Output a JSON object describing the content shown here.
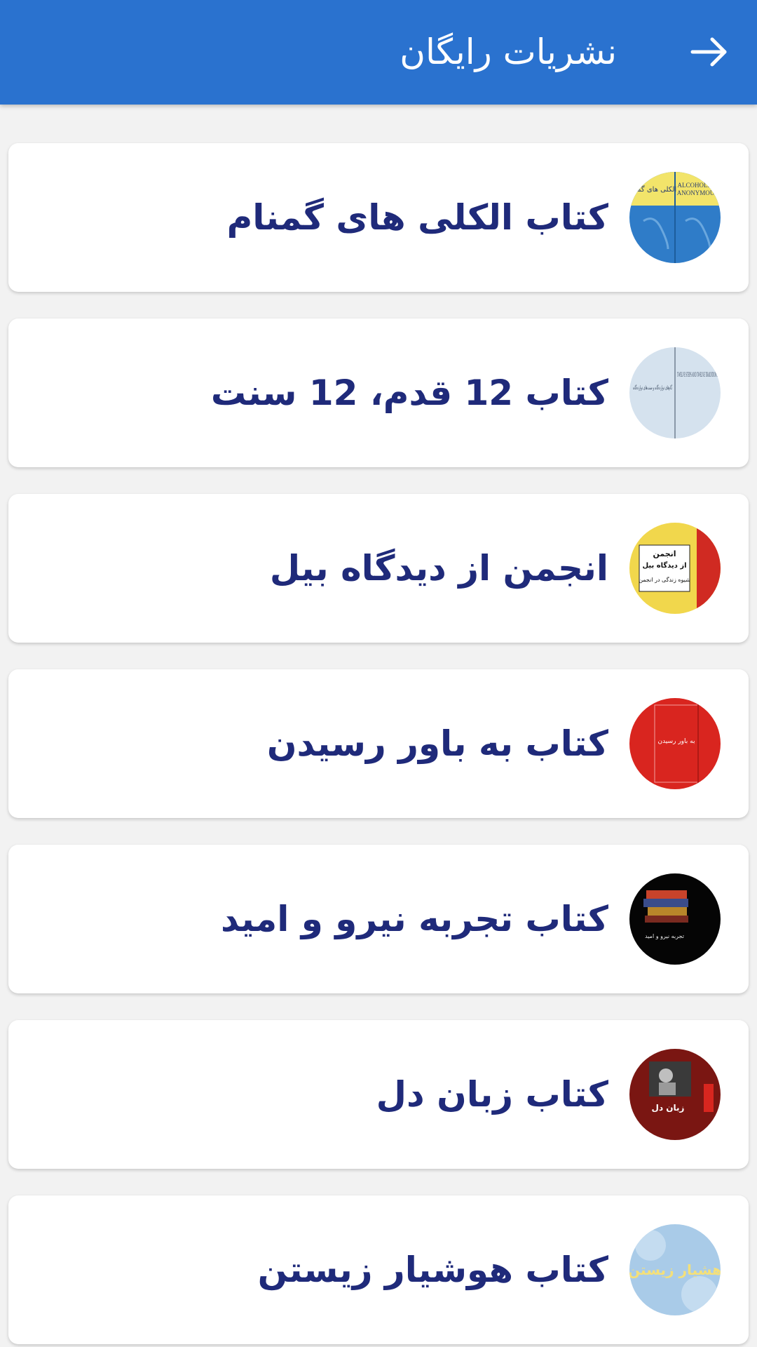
{
  "appbar": {
    "title": "نشریات رایگان",
    "back_icon": "arrow-right-icon",
    "color": "#2a72cf"
  },
  "colors": {
    "item_text": "#1f2a7a",
    "background": "#f2f2f2",
    "card": "#ffffff"
  },
  "items": [
    {
      "label": "کتاب الکلی های گمنام",
      "thumb_icon": "book-cover-alcoholics-anonymous",
      "cover_text_1": "ALCOHOLICS",
      "cover_text_2": "ANONYMOUS",
      "cover_text_3": "الکلی های گمنام"
    },
    {
      "label": "کتاب 12 قدم، 12 سنت",
      "thumb_icon": "book-cover-twelve-steps",
      "cover_text_1": "TWELVE STEPS AND TWELVE TRADITIONS",
      "cover_text_2": "گام‌های دوازده‌گانه و سنت‌های دوازده‌گانه"
    },
    {
      "label": "انجمن از دیدگاه بیل",
      "thumb_icon": "book-cover-as-bill-sees-it",
      "cover_text_1": "انجمن",
      "cover_text_2": "از دیدگاه بیل",
      "cover_text_3": "شیوه زندگی در انجمن"
    },
    {
      "label": "کتاب به باور رسیدن",
      "thumb_icon": "book-cover-came-to-believe",
      "cover_text_1": "به باور رسیدن"
    },
    {
      "label": "کتاب تجربه نیرو و امید",
      "thumb_icon": "book-cover-experience-strength-hope",
      "cover_text_1": "تجربه نیرو و امید"
    },
    {
      "label": "کتاب زبان دل",
      "thumb_icon": "book-cover-language-of-the-heart",
      "cover_text_1": "زبان دل"
    },
    {
      "label": "کتاب هوشیار زیستن",
      "thumb_icon": "book-cover-living-sober",
      "cover_text_1": "هشیار زیستن"
    }
  ]
}
